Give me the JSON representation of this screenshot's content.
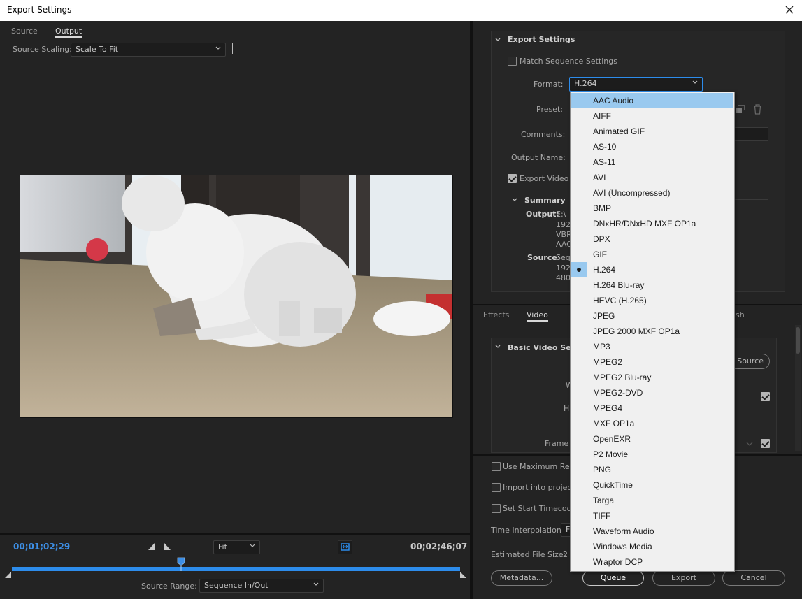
{
  "window": {
    "title": "Export Settings"
  },
  "left": {
    "tabs": [
      {
        "label": "Source"
      },
      {
        "label": "Output"
      }
    ],
    "source_scaling": {
      "label": "Source Scaling:",
      "value": "Scale To Fit"
    },
    "timeline": {
      "current_time": "00;01;02;29",
      "duration": "00;02;46;07",
      "zoom_value": "Fit",
      "source_range_label": "Source Range:",
      "source_range_value": "Sequence In/Out"
    }
  },
  "right": {
    "export_settings": {
      "header": "Export Settings",
      "match_sequence": "Match Sequence Settings",
      "format_label": "Format:",
      "format_value": "H.264",
      "preset_label": "Preset:",
      "comments_label": "Comments:",
      "output_name_label": "Output Name:",
      "export_video": "Export Video",
      "summary_header": "Summary",
      "output_label": "Output:",
      "output_lines": [
        "E:\\",
        "192",
        "VBR",
        "AAC"
      ],
      "source_label": "Source:",
      "source_lines": [
        "Seq",
        "192",
        "480"
      ]
    },
    "tabs": [
      {
        "label": "Effects"
      },
      {
        "label": "Video"
      },
      {
        "label": "ish"
      }
    ],
    "basic_video": {
      "header": "Basic Video Setti",
      "match_source_btn": "Source",
      "w_label": "W",
      "h_label": "H",
      "frame_label": "Frame"
    },
    "bottom": {
      "use_max_render": "Use Maximum Ren",
      "import_into_project": "Import into project",
      "set_start_timecode": "Set Start Timecode",
      "time_interpolation_label": "Time Interpolation:",
      "time_interpolation_value": "F",
      "estimated_file_size_label": "Estimated File Size:",
      "estimated_file_size_value": "2"
    },
    "buttons": {
      "metadata": "Metadata...",
      "queue": "Queue",
      "export": "Export",
      "cancel": "Cancel"
    }
  },
  "format_dropdown": {
    "highlighted": "AAC Audio",
    "selected": "H.264",
    "options": [
      "AAC Audio",
      "AIFF",
      "Animated GIF",
      "AS-10",
      "AS-11",
      "AVI",
      "AVI (Uncompressed)",
      "BMP",
      "DNxHR/DNxHD MXF OP1a",
      "DPX",
      "GIF",
      "H.264",
      "H.264 Blu-ray",
      "HEVC (H.265)",
      "JPEG",
      "JPEG 2000 MXF OP1a",
      "MP3",
      "MPEG2",
      "MPEG2 Blu-ray",
      "MPEG2-DVD",
      "MPEG4",
      "MXF OP1a",
      "OpenEXR",
      "P2 Movie",
      "PNG",
      "QuickTime",
      "Targa",
      "TIFF",
      "Waveform Audio",
      "Windows Media",
      "Wraptor DCP"
    ]
  },
  "colors": {
    "accent_blue": "#2d8ceb",
    "timecode_blue": "#3d8fe6",
    "highlight": "#99c9ef"
  }
}
